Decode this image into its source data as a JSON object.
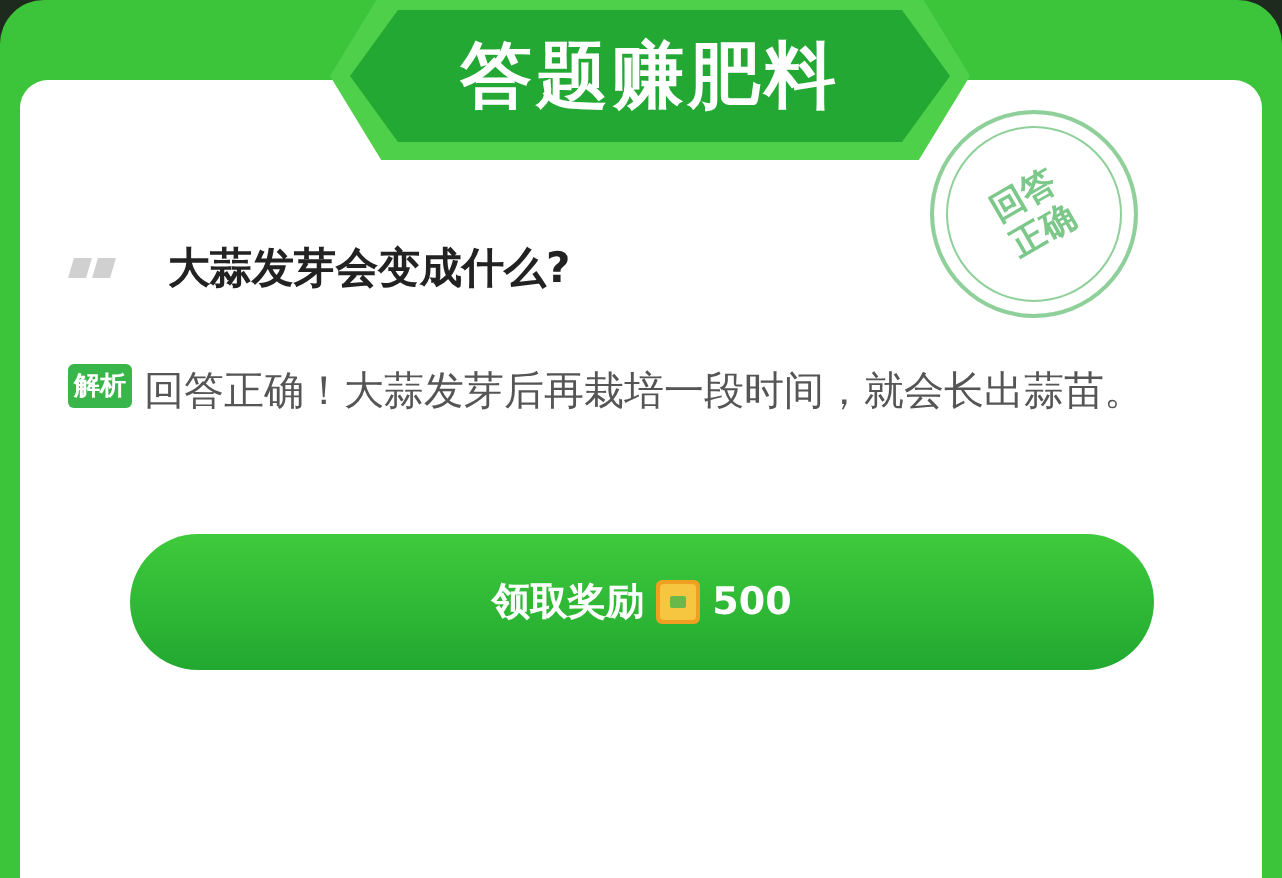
{
  "title": "答题赚肥料",
  "stamp": {
    "lines": [
      "回答",
      "正确"
    ]
  },
  "question": "大蒜发芽会变成什么?",
  "explanation": {
    "badge": "解析",
    "text": "回答正确！大蒜发芽后再栽培一段时间，就会长出蒜苗。"
  },
  "reward_button": {
    "label": "领取奖励",
    "amount": "500"
  }
}
